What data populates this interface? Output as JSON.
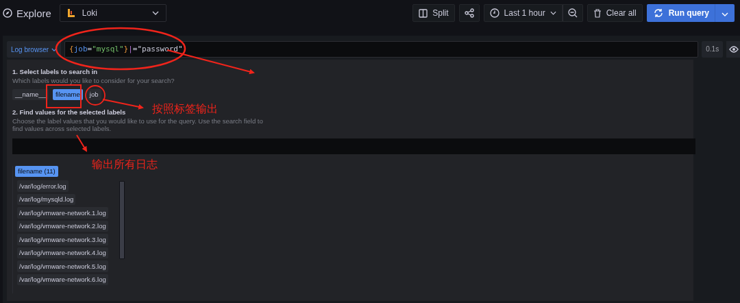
{
  "header": {
    "title": "Explore",
    "datasource": "Loki",
    "split": "Split",
    "time_range": "Last 1 hour",
    "clear": "Clear all",
    "run": "Run query"
  },
  "query": {
    "browser_button": "Log browser",
    "duration": "0.1s",
    "tokens": [
      {
        "text": "{",
        "kind": "brace"
      },
      {
        "text": "job",
        "kind": "label"
      },
      {
        "text": "=",
        "kind": "op"
      },
      {
        "text": "\"mysql\"",
        "kind": "value"
      },
      {
        "text": "}",
        "kind": "brace"
      },
      {
        "text": "|",
        "kind": "pipe"
      },
      {
        "text": "=",
        "kind": "op"
      },
      {
        "text": "\"password\"",
        "kind": "text"
      }
    ]
  },
  "browser": {
    "step1_title": "1. Select labels to search in",
    "step1_hint": "Which labels would you like to consider for your search?",
    "labels": [
      {
        "label": "__name__",
        "selected": false
      },
      {
        "label": "filename",
        "selected": true
      },
      {
        "label": "job",
        "selected": false
      }
    ],
    "step2_title": "2. Find values for the selected labels",
    "step2_hint": "Choose the label values that you would like to use for the query. Use the search field to find values across selected labels.",
    "value_group": "filename (11)",
    "values": [
      "/var/log/error.log",
      "/var/log/mysqld.log",
      "/var/log/vmware-network.1.log",
      "/var/log/vmware-network.2.log",
      "/var/log/vmware-network.3.log",
      "/var/log/vmware-network.4.log",
      "/var/log/vmware-network.5.log",
      "/var/log/vmware-network.6.log"
    ]
  },
  "annotations": [
    {
      "text": "按照标签输出"
    },
    {
      "text": "输出所有日志"
    }
  ]
}
